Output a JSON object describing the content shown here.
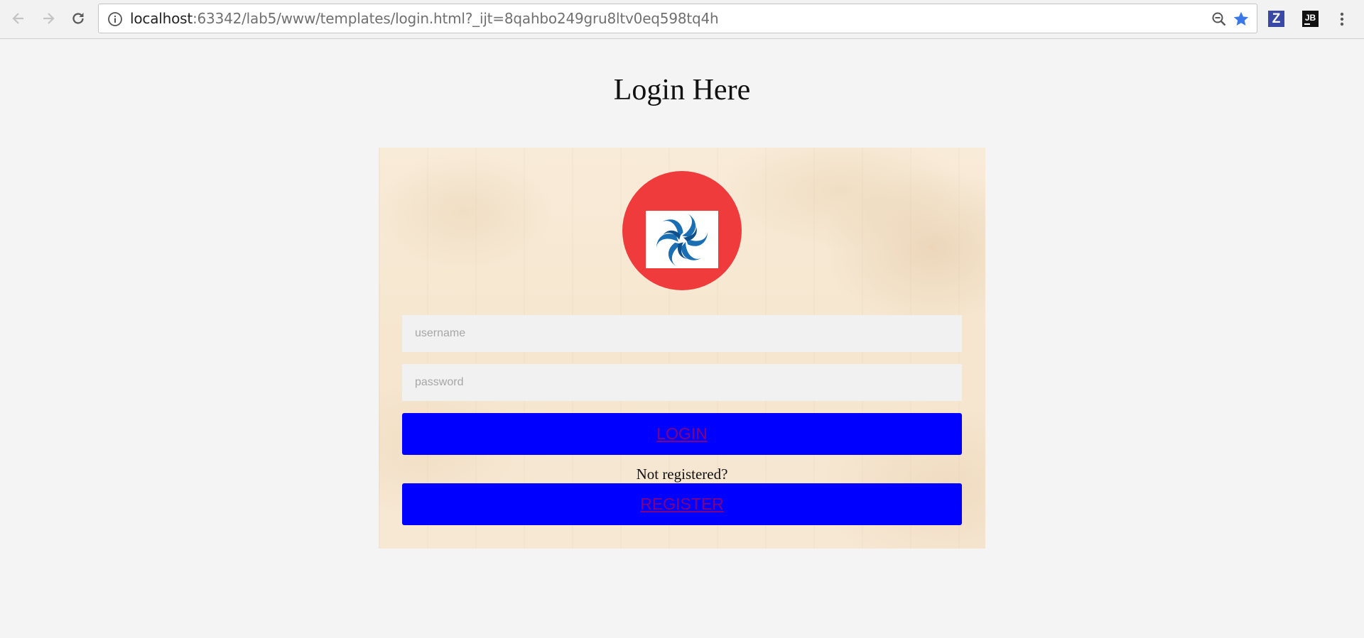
{
  "browser": {
    "url_host": "localhost",
    "url_rest": ":63342/lab5/www/templates/login.html?_ijt=8qahbo249gru8ltv0eq598tq4h",
    "back_icon": "arrow-left-icon",
    "forward_icon": "arrow-right-icon",
    "reload_icon": "reload-icon",
    "info_icon": "info-icon",
    "zoom_icon": "zoom-out-icon",
    "bookmark_icon": "star-icon",
    "extensions": [
      {
        "label": "Z",
        "icon": "zotero-icon",
        "color": "#3a49a5"
      },
      {
        "label": "JB",
        "icon": "jetbrains-icon",
        "color": "#111111"
      }
    ],
    "menu_icon": "kebab-menu-icon"
  },
  "page": {
    "title": "Login Here"
  },
  "form": {
    "username_placeholder": "username",
    "password_placeholder": "password",
    "login_label": "LOGIN",
    "not_registered_text": "Not registered?",
    "register_label": "REGISTER"
  },
  "colors": {
    "avatar_bg": "#ef3b3c",
    "button_bg": "#0000ff",
    "link_text": "#800080",
    "logo_blue": "#1a6fb4"
  }
}
